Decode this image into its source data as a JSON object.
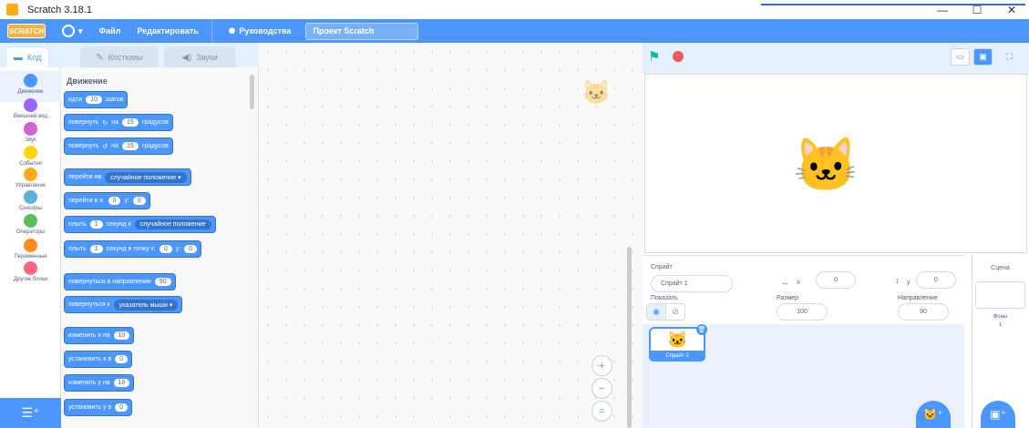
{
  "window": {
    "title": "Scratch 3.18.1",
    "controls": [
      "—",
      "☐",
      "✕"
    ]
  },
  "menubar": {
    "logo_text": "SCRATCH",
    "items": [
      "Файл",
      "Редактировать",
      "Руководства"
    ],
    "project_title": "Проект Scratch"
  },
  "tabs": [
    {
      "icon": "▬",
      "label": "Код"
    },
    {
      "icon": "✎",
      "label": "Костюмы"
    },
    {
      "icon": "◀)",
      "label": "Звуки"
    }
  ],
  "categories": [
    {
      "label": "Движение",
      "color": "#4c97ff"
    },
    {
      "label": "Внешний вид",
      "color": "#9966ff"
    },
    {
      "label": "Звук",
      "color": "#cf63cf"
    },
    {
      "label": "События",
      "color": "#ffd500"
    },
    {
      "label": "Управление",
      "color": "#ffab19"
    },
    {
      "label": "Сенсоры",
      "color": "#5cb1d6"
    },
    {
      "label": "Операторы",
      "color": "#59c059"
    },
    {
      "label": "Переменные",
      "color": "#ff8c1a"
    },
    {
      "label": "Другие блоки",
      "color": "#ff6680"
    }
  ],
  "palette": {
    "title": "Движение",
    "blocks": {
      "b1": {
        "t1": "идти",
        "v1": "10",
        "t2": "шагов"
      },
      "b2": {
        "t1": "повернуть",
        "icon": "↻",
        "t2": "на",
        "v1": "15",
        "t3": "градусов"
      },
      "b3": {
        "t1": "повернуть",
        "icon": "↺",
        "t2": "на",
        "v1": "15",
        "t3": "градусов"
      },
      "b4": {
        "t1": "перейти на",
        "d1": "случайное положение ▾"
      },
      "b5": {
        "t1": "перейти в x:",
        "v1": "0",
        "t2": "y:",
        "v2": "0"
      },
      "b6": {
        "t1": "плыть",
        "v1": "1",
        "t2": "секунд к",
        "d1": "случайное положение"
      },
      "b7": {
        "t1": "плыть",
        "v1": "1",
        "t2": "секунд в точку x:",
        "v2": "0",
        "t3": "y:",
        "v3": "0"
      },
      "b8": {
        "t1": "повернуться в направлении",
        "v1": "90"
      },
      "b9": {
        "t1": "повернуться к",
        "d1": "указатель мыши ▾"
      },
      "b10": {
        "t1": "изменить х на",
        "v1": "10"
      },
      "b11": {
        "t1": "установить х в",
        "v1": "0"
      },
      "b12": {
        "t1": "изменить у на",
        "v1": "10"
      },
      "b13": {
        "t1": "установить у в",
        "v1": "0"
      }
    }
  },
  "zoom": [
    "+",
    "−",
    "="
  ],
  "sprite_info": {
    "sprite_label": "Спрайт",
    "sprite_name": "Спрайт 1",
    "x_label": "x",
    "x_value": "0",
    "y_label": "y",
    "y_value": "0",
    "show_label": "Показать",
    "size_label": "Размер",
    "size_value": "100",
    "direction_label": "Направление",
    "direction_value": "90"
  },
  "sprite_tile": {
    "label": "Спрайт 1"
  },
  "stage_pane": {
    "title": "Сцена",
    "backdrops_label": "Фоны",
    "backdrops_count": "1"
  }
}
